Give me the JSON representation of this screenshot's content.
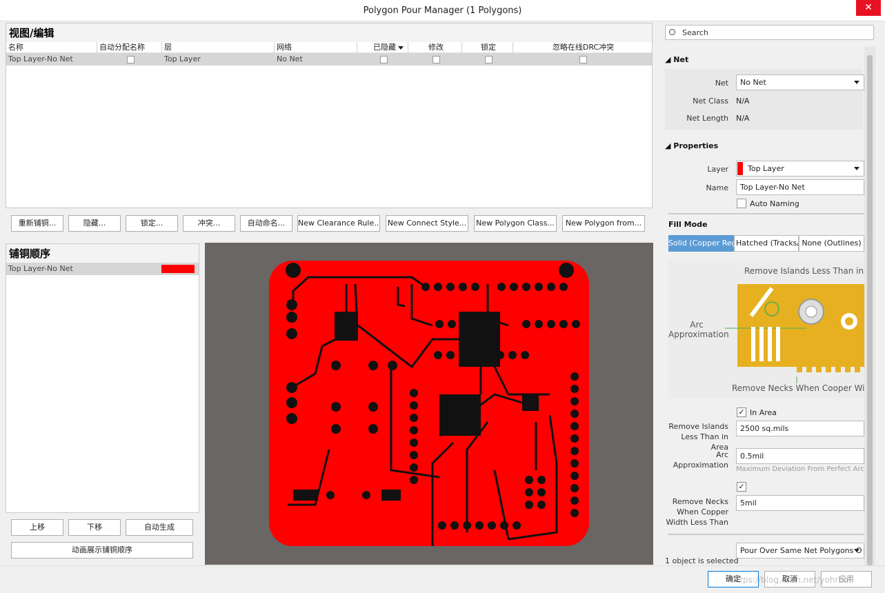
{
  "window": {
    "title": "Polygon Pour Manager (1 Polygons)",
    "close_glyph": "✕"
  },
  "view_edit": {
    "title": "视图/编辑",
    "columns": [
      "名称",
      "自动分配名称",
      "层",
      "网络",
      "已隐藏",
      "修改",
      "锁定",
      "忽略在线DRC冲突"
    ],
    "row": {
      "name": "Top Layer-No Net",
      "layer": "Top Layer",
      "net": "No Net"
    }
  },
  "toolbar": {
    "repour": "重新铺铜...",
    "hide": "隐藏...",
    "lock": "锁定...",
    "conflict": "冲突...",
    "autoname": "自动命名...",
    "new_clearance": "New Clearance Rule...",
    "new_connect": "New Connect Style...",
    "new_class": "New Polygon Class...",
    "new_from": "New Polygon from..."
  },
  "pour_order": {
    "title": "铺铜顺序",
    "item": "Top Layer-No Net",
    "item_color": "#ff0000",
    "up": "上移",
    "down": "下移",
    "auto": "自动生成",
    "animate": "动画展示铺铜顺序"
  },
  "right": {
    "search_placeholder": "Search",
    "net_section": "Net",
    "net_label": "Net",
    "net_value": "No Net",
    "netclass_label": "Net Class",
    "netclass_value": "N/A",
    "netlength_label": "Net Length",
    "netlength_value": "N/A",
    "props_section": "Properties",
    "layer_label": "Layer",
    "layer_value": "Top Layer",
    "layer_color": "#ff0000",
    "name_label": "Name",
    "name_value": "Top Layer-No Net",
    "auto_naming": "Auto Naming",
    "fill_mode": "Fill Mode",
    "fill_solid": "Solid (Copper Regi",
    "fill_hatched": "Hatched (Tracks/Ar",
    "fill_none": "None (Outlines)",
    "diag_islands": "Remove Islands Less Than in Area",
    "diag_arc": "Arc\nApproximation",
    "diag_necks": "Remove Necks When Cooper Width",
    "in_area": "In Area",
    "islands_label": "Remove Islands Less Than in Area",
    "islands_value": "2500 sq.mils",
    "arc_label": "Arc Approximation",
    "arc_value": "0.5mil",
    "arc_hint": "Maximum Deviation From Perfect Arc",
    "necks_label": "Remove Necks When Copper Width Less Than",
    "necks_value": "5mil",
    "pour_over": "Pour Over Same Net Polygons O",
    "status": "1 object is selected"
  },
  "footer": {
    "ok": "确定",
    "cancel": "取消",
    "apply": "应用",
    "watermark": "https://blog.csdn.net/yohrbai"
  },
  "colors": {
    "pour": "#ff0000",
    "board_bg": "#6a6664",
    "select_blue": "#5b9bd5",
    "pad_gold": "#e6b020"
  }
}
